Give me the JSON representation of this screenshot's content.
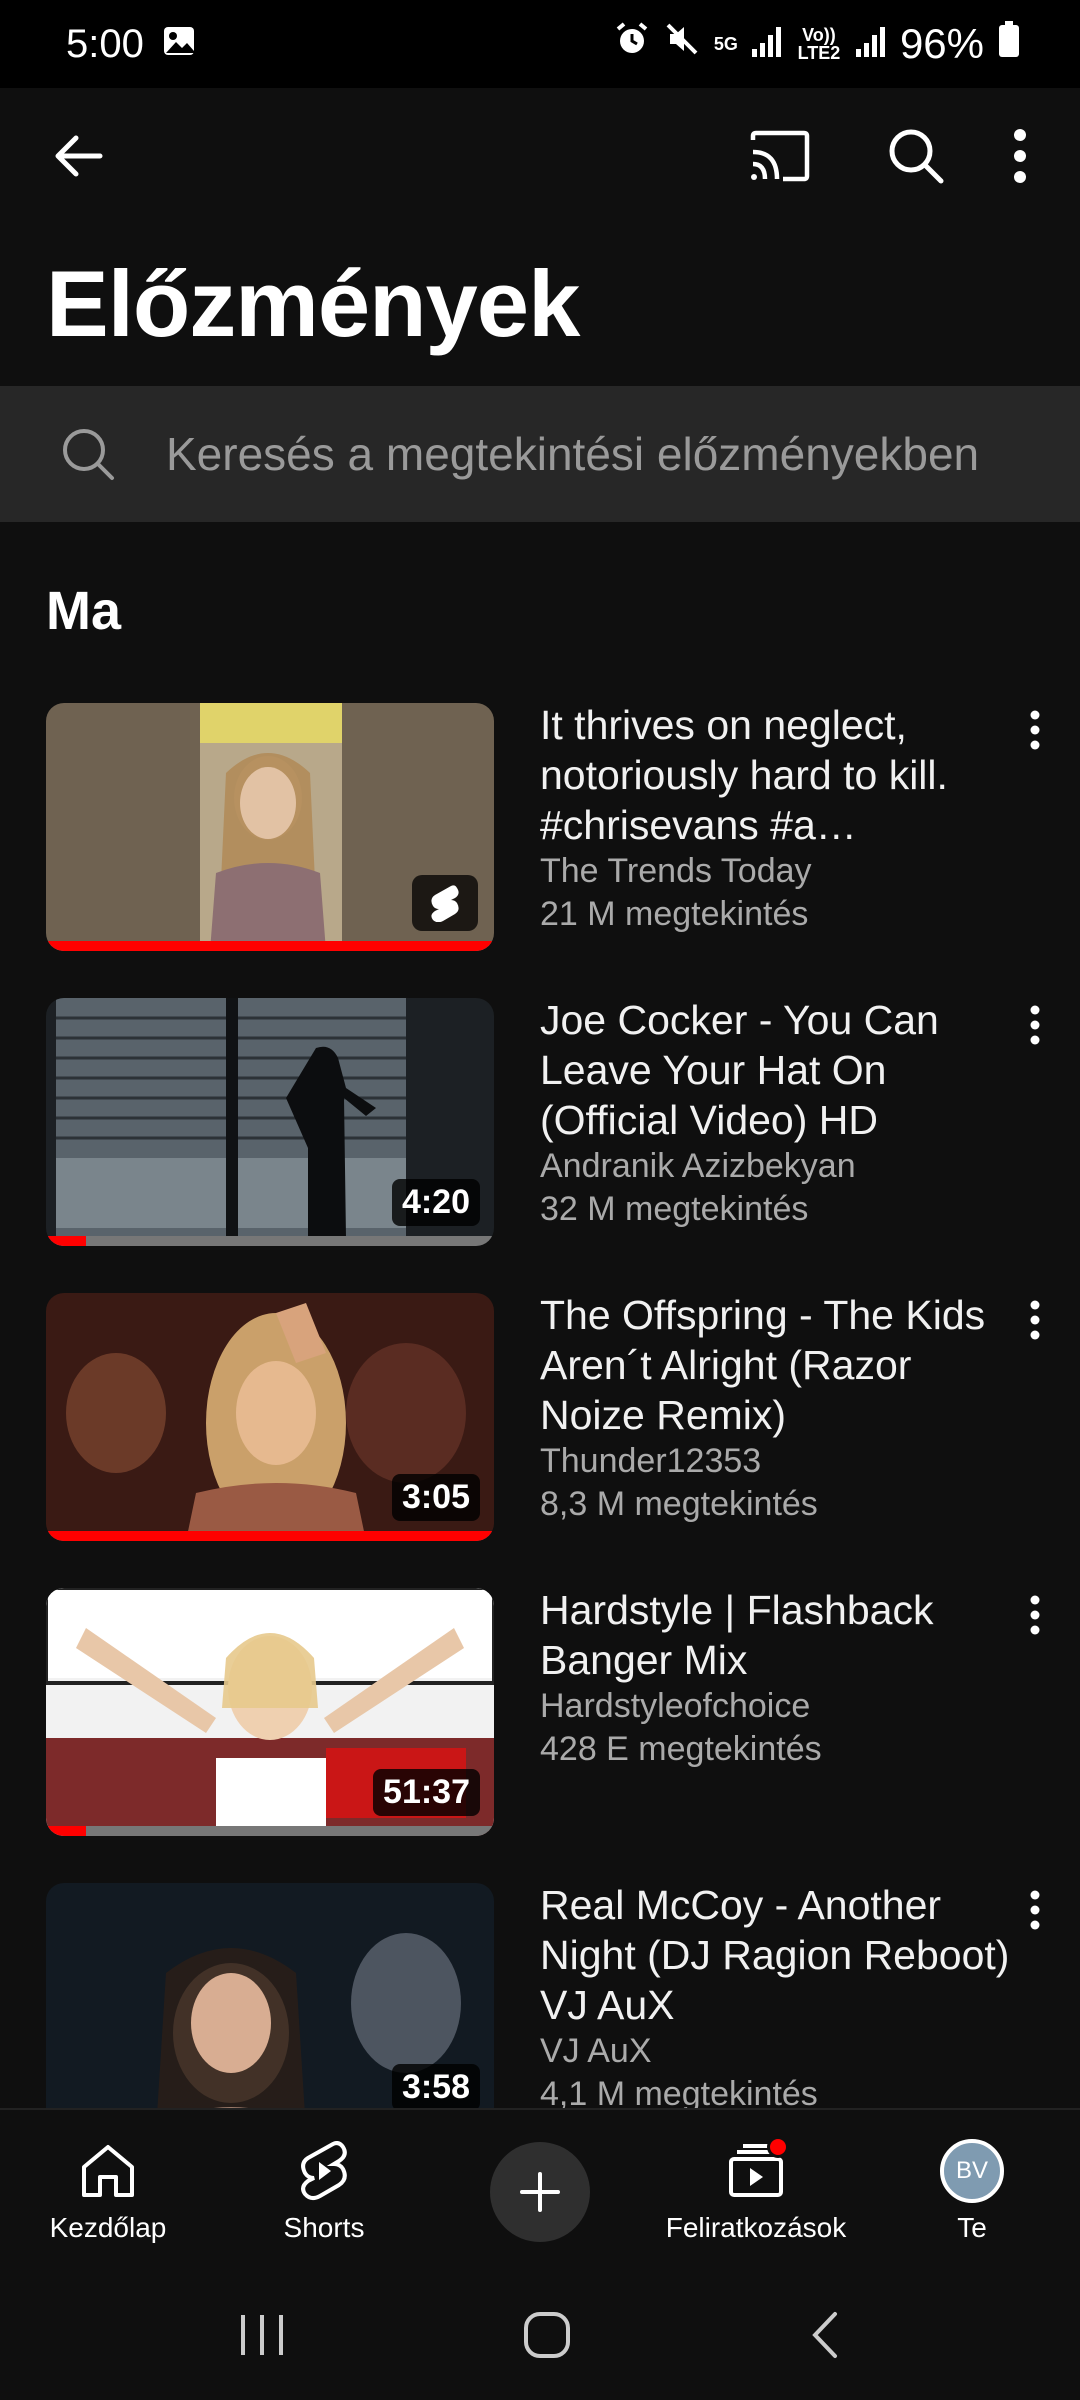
{
  "status_bar": {
    "time": "5:00",
    "network_5g": "5G",
    "volte": "Vo)) LTE2",
    "battery_percent": "96%"
  },
  "app_bar": {
    "page_title": "Előzmények"
  },
  "search": {
    "placeholder": "Keresés a megtekintési előzményekben"
  },
  "section": {
    "title": "Ma"
  },
  "videos": [
    {
      "title": "It thrives on neglect, notoriously hard to kill. #chrisevans  #a…",
      "channel": "The Trends Today",
      "views": "21 M megtekintés",
      "duration": "",
      "is_short": true,
      "progress": 1.0
    },
    {
      "title": "Joe Cocker - You Can Leave Your Hat On (Official Video) HD",
      "channel": "Andranik Azizbekyan",
      "views": "32 M megtekintés",
      "duration": "4:20",
      "is_short": false,
      "progress": 0.09
    },
    {
      "title": "The Offspring - The Kids Aren´t Alright (Razor Noize Remix)",
      "channel": "Thunder12353",
      "views": "8,3 M megtekintés",
      "duration": "3:05",
      "is_short": false,
      "progress": 1.0
    },
    {
      "title": "Hardstyle | Flashback Banger Mix",
      "channel": "Hardstyleofchoice",
      "views": "428 E megtekintés",
      "duration": "51:37",
      "is_short": false,
      "progress": 0.09
    },
    {
      "title": "Real McCoy - Another Night (DJ Ragion Reboot) VJ AuX",
      "channel": "VJ AuX",
      "views": "4,1 M megtekintés",
      "duration": "3:58",
      "is_short": false,
      "progress": 0
    }
  ],
  "bottom_nav": {
    "home": "Kezdőlap",
    "shorts": "Shorts",
    "subscriptions": "Feliratkozások",
    "you": "Te",
    "avatar_initials": "BV"
  },
  "colors": {
    "background": "#0f0f0f",
    "progress_red": "#ff0000",
    "secondary_text": "#aaaaaa"
  }
}
